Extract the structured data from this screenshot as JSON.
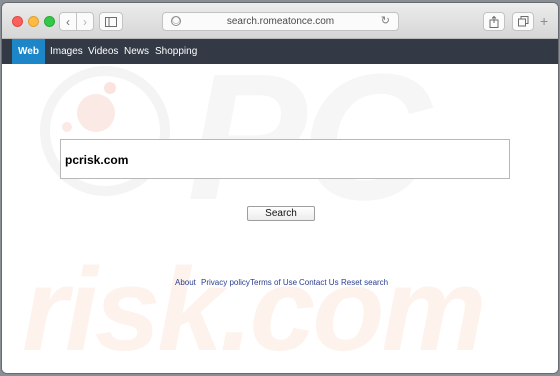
{
  "browser": {
    "url": "search.romeatonce.com",
    "icons": {
      "back": "chevron-left-icon",
      "forward": "chevron-right-icon",
      "sidebar": "sidebar-icon",
      "privacy": "privacy-icon",
      "reload": "reload-icon",
      "share": "share-icon",
      "tabs": "tabs-icon",
      "new_tab": "plus-icon"
    }
  },
  "nav": {
    "items": [
      {
        "label": "Web",
        "active": true
      },
      {
        "label": "Images",
        "active": false
      },
      {
        "label": "Videos",
        "active": false
      },
      {
        "label": "News",
        "active": false
      },
      {
        "label": "Shopping",
        "active": false
      }
    ]
  },
  "search": {
    "value": "pcrisk.com",
    "button_label": "Search"
  },
  "footer": {
    "links": [
      "About",
      "Privacy policy",
      "Terms of Use",
      "Contact Us",
      "Reset search"
    ]
  },
  "watermark": {
    "line1": "PC",
    "line2": "risk.com"
  },
  "colors": {
    "nav_background": "#333a45",
    "nav_active": "#1c86c8",
    "footer_link": "#2a3f8f"
  }
}
